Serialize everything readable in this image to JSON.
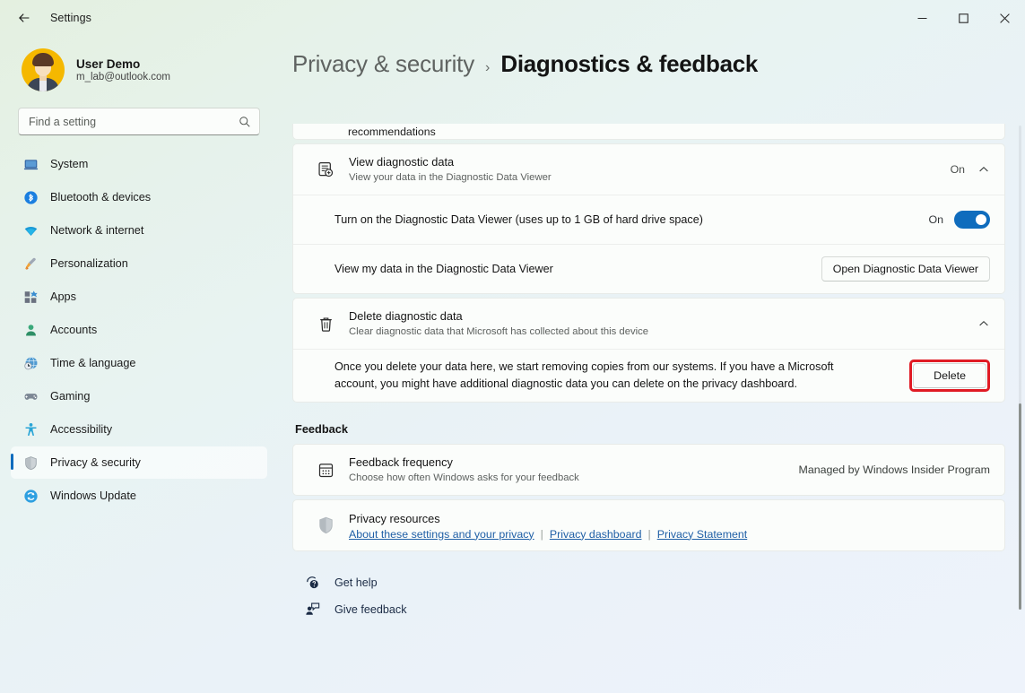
{
  "window": {
    "app_title": "Settings",
    "back_icon": "back-arrow-icon",
    "minimize_label": "Minimize",
    "maximize_label": "Maximize",
    "close_label": "Close"
  },
  "sidebar": {
    "account": {
      "name": "User Demo",
      "email": "m_lab@outlook.com",
      "avatar_icon": "user-avatar"
    },
    "search": {
      "placeholder": "Find a setting",
      "value": "",
      "icon": "search-icon"
    },
    "items": [
      {
        "label": "System",
        "icon": "system-icon",
        "active": false
      },
      {
        "label": "Bluetooth & devices",
        "icon": "bluetooth-icon",
        "active": false
      },
      {
        "label": "Network & internet",
        "icon": "wifi-icon",
        "active": false
      },
      {
        "label": "Personalization",
        "icon": "paintbrush-icon",
        "active": false
      },
      {
        "label": "Apps",
        "icon": "apps-icon",
        "active": false
      },
      {
        "label": "Accounts",
        "icon": "accounts-icon",
        "active": false
      },
      {
        "label": "Time & language",
        "icon": "clock-globe-icon",
        "active": false
      },
      {
        "label": "Gaming",
        "icon": "gamepad-icon",
        "active": false
      },
      {
        "label": "Accessibility",
        "icon": "accessibility-icon",
        "active": false
      },
      {
        "label": "Privacy & security",
        "icon": "shield-icon",
        "active": true
      },
      {
        "label": "Windows Update",
        "icon": "update-icon",
        "active": false
      }
    ]
  },
  "header": {
    "parent_crumb": "Privacy & security",
    "separator": "›",
    "current_crumb": "Diagnostics & feedback"
  },
  "main": {
    "clipped_row_text": "recommendations",
    "view_diagnostic_data": {
      "title": "View diagnostic data",
      "subtitle": "View your data in the Diagnostic Data Viewer",
      "status": "On",
      "icon": "view-data-icon",
      "chevron": "chevron-up-icon",
      "children": [
        {
          "label": "Turn on the Diagnostic Data Viewer (uses up to 1 GB of hard drive space)",
          "control": "toggle",
          "toggle_state": "On",
          "toggle_on": true
        },
        {
          "label": "View my data in the Diagnostic Data Viewer",
          "control": "button",
          "button_label": "Open Diagnostic Data Viewer"
        }
      ]
    },
    "delete_diagnostic_data": {
      "title": "Delete diagnostic data",
      "subtitle": "Clear diagnostic data that Microsoft has collected about this device",
      "icon": "trash-icon",
      "chevron": "chevron-up-icon",
      "body_text": "Once you delete your data here, we start removing copies from our systems. If you have a Microsoft account, you might have additional diagnostic data you can delete on the privacy dashboard.",
      "button_label": "Delete",
      "highlight_color": "#e01b24"
    },
    "feedback_section": {
      "heading": "Feedback",
      "feedback_frequency": {
        "title": "Feedback frequency",
        "subtitle": "Choose how often Windows asks for your feedback",
        "status": "Managed by Windows Insider Program",
        "icon": "calendar-icon"
      },
      "privacy_resources": {
        "title": "Privacy resources",
        "icon": "shield-grey-icon",
        "links": [
          "About these settings and your privacy",
          "Privacy dashboard",
          "Privacy Statement"
        ],
        "link_separator": "|"
      }
    },
    "footer": [
      {
        "label": "Get help",
        "icon": "get-help-icon"
      },
      {
        "label": "Give feedback",
        "icon": "give-feedback-icon"
      }
    ]
  },
  "colors": {
    "accent": "#0f6cbd",
    "highlight": "#e01b24",
    "link": "#1f5fa6"
  }
}
